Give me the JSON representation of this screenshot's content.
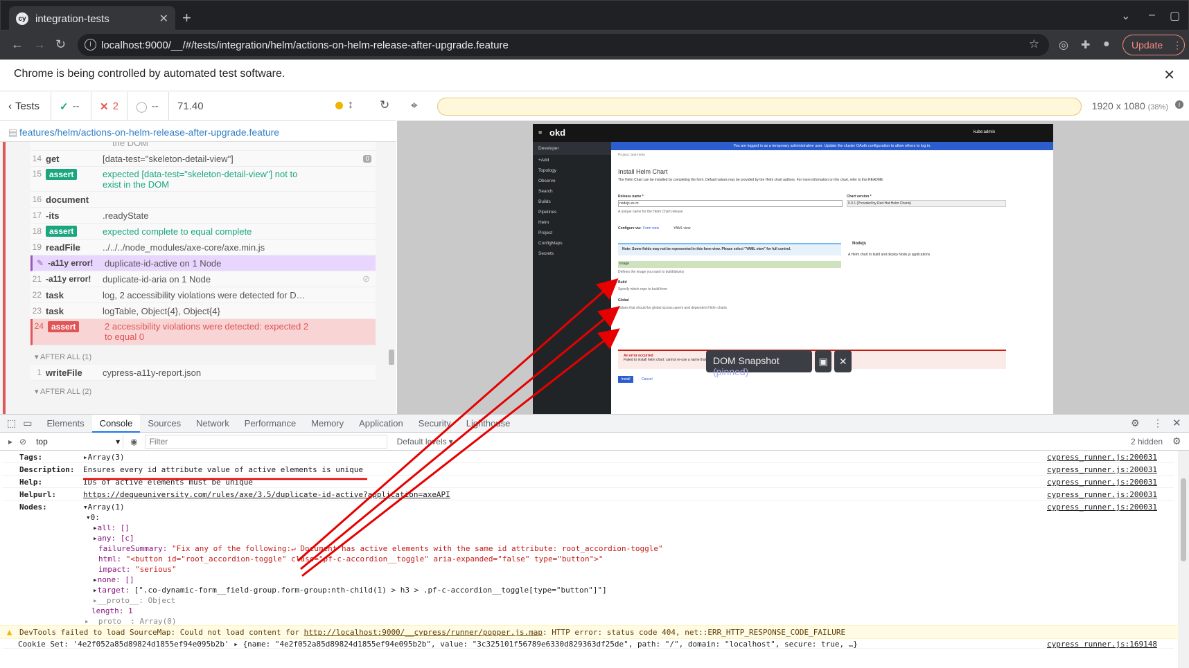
{
  "browser": {
    "tab_title": "integration-tests",
    "tab_favicon": "cy",
    "url": "localhost:9000/__/#/tests/integration/helm/actions-on-helm-release-after-upgrade.feature",
    "update_label": "Update",
    "infobar_text": "Chrome is being controlled by automated test software."
  },
  "reporter": {
    "tests_label": "Tests",
    "passed": "--",
    "failed": "2",
    "pending": "--",
    "duration": "71.40",
    "spec_path": "features/helm/actions-on-helm-release-after-upgrade.feature",
    "prev_line": "the DOM",
    "commands": [
      {
        "num": "14",
        "name": "get",
        "msg": "[data-test=\"skeleton-detail-view\"]",
        "count": "0"
      },
      {
        "num": "15",
        "name": "assert",
        "badge": "assert",
        "msg": "expected [data-test=\"skeleton-detail-view\"] not to",
        "msg2": "exist in the DOM"
      },
      {
        "num": "16",
        "name": "document",
        "msg": ""
      },
      {
        "num": "17",
        "name": "-its",
        "msg": ".readyState"
      },
      {
        "num": "18",
        "name": "assert",
        "badge": "assert",
        "msg": "expected complete to equal complete"
      },
      {
        "num": "19",
        "name": "readFile",
        "msg": "../../../node_modules/axe-core/axe.min.js"
      },
      {
        "num": "20",
        "name": "-a11y error!",
        "msg": "duplicate-id-active on 1 Node"
      },
      {
        "num": "21",
        "name": "-a11y error!",
        "msg": "duplicate-id-aria on 1 Node"
      },
      {
        "num": "22",
        "name": "task",
        "msg": "log, 2 accessibility violations were detected for D…"
      },
      {
        "num": "23",
        "name": "task",
        "msg": "logTable, Object{4}, Object{4}"
      },
      {
        "num": "24",
        "name": "assert",
        "badge": "assert",
        "msg": "2 accessibility violations were detected: expected 2",
        "msg2": "to equal 0"
      }
    ],
    "after_all_1": "AFTER ALL (1)",
    "after_cmd": {
      "num": "1",
      "name": "writeFile",
      "msg": "cypress-a11y-report.json"
    },
    "after_all_2": "AFTER ALL (2)"
  },
  "aut": {
    "viewport": "1920 x 1080",
    "scale": "(38%)",
    "snapshot": {
      "brand": "okd",
      "banner": "You are logged in as a temporary administrative user. Update the cluster OAuth configuration to allow others to log in.",
      "user": "kube:admin",
      "perspective": "Developer",
      "nav": [
        "+Add",
        "Topology",
        "Observe",
        "Search",
        "Builds",
        "Pipelines",
        "Helm",
        "Project",
        "ConfigMaps",
        "Secrets"
      ],
      "breadcrumb": "Project: test-helm",
      "page_title": "Install Helm Chart",
      "page_desc": "The Helm Chart can be installed by completing the form. Default values may be provided by the Helm chart authors. For more information on the chart, refer to this README",
      "release_label": "Release name *",
      "release_value": "nodejs-ex-m",
      "release_help": "A unique name for the Helm Chart release",
      "chart_version_label": "Chart version *",
      "chart_version_value": "0.0.1 (Provided by Red Hat Helm Charts)",
      "configure_via": "Configure via:",
      "form_view": "Form view",
      "yaml_view": "YAML view",
      "note": "Note: Some fields may not be represented in this form view. Please select \"YAML view\" for full control.",
      "chart_name": "Nodejs",
      "chart_desc": "A Helm chart to build and deploy Node.js applications",
      "acc_image": "Image",
      "acc_image_desc": "Defines the image you want to build/deploy",
      "acc_build": "Build",
      "acc_build_desc": "Specify which repo to build from",
      "acc_global": "Global",
      "acc_global_desc": "Values that should be global across parent and dependent Helm charts",
      "error_title": "An error occurred",
      "error_desc": "Failed to install helm chart: cannot re-use a name that is still in use",
      "install_btn": "Install",
      "cancel_btn": "Cancel"
    },
    "dom_snapshot_label": "DOM Snapshot",
    "dom_snapshot_state": "(pinned)"
  },
  "devtools": {
    "tabs": [
      "Elements",
      "Console",
      "Sources",
      "Network",
      "Performance",
      "Memory",
      "Application",
      "Security",
      "Lighthouse"
    ],
    "active_tab": "Console",
    "context": "top",
    "filter_placeholder": "Filter",
    "levels": "Default levels",
    "hidden": "2 hidden",
    "source": "cypress_runner.js:200031",
    "rows": {
      "tags_k": "Tags:",
      "tags_v": "Array(3)",
      "desc_k": "Description:",
      "desc_v": "Ensures every id attribute value of active elements is unique",
      "help_k": "Help:",
      "help_v": "IDs of active elements must be unique",
      "helpurl_k": "Helpurl:",
      "helpurl_v": "https://dequeuniversity.com/rules/axe/3.5/duplicate-id-active?application=axeAPI",
      "nodes_k": "Nodes:",
      "nodes_v": "Array(1)"
    },
    "tree": {
      "idx": "0:",
      "all": "all: []",
      "any": "any: [c]",
      "fs_key": "failureSummary:",
      "fs_val": "\"Fix any of the following:↵  Document has active elements with the same id attribute: root_accordion-toggle\"",
      "html_key": "html:",
      "html_val": "\"<button id=\"root_accordion-toggle\" class=\"pf-c-accordion__toggle\" aria-expanded=\"false\" type=\"button\">\"",
      "impact_key": "impact:",
      "impact_val": "\"serious\"",
      "none": "none: []",
      "target_key": "target:",
      "target_val": "[\".co-dynamic-form__field-group.form-group:nth-child(1) > h3 > .pf-c-accordion__toggle[type=\"button\"]\"]",
      "proto1": "__proto__: Object",
      "length": "length: 1",
      "proto2": "__proto__: Array(0)"
    },
    "warning_pre": "DevTools failed to load SourceMap: Could not load content for ",
    "warning_link": "http://localhost:9000/__cypress/runner/popper.js.map",
    "warning_post": ": HTTP error: status code 404, net::ERR_HTTP_RESPONSE_CODE_FAILURE",
    "cookie_line": "Cookie Set: '4e2f052a85d89824d1855ef94e095b2b' ▸ {name: \"4e2f052a85d89824d1855ef94e095b2b\", value: \"3c325101f56789e6330d829363df25de\", path: \"/\", domain: \"localhost\", secure: true, …}",
    "cookie_src": "cypress_runner.js:169148"
  },
  "colors": {
    "annotation": "#e60000",
    "assert_pass": "#1aa67f",
    "assert_fail": "#e05555",
    "pinned": "#9b59b6"
  }
}
